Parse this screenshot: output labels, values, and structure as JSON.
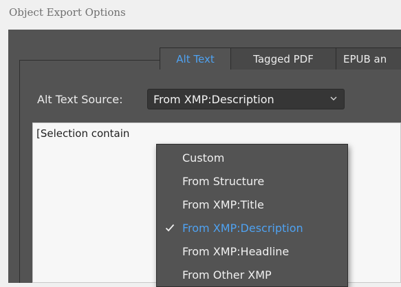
{
  "window": {
    "title": "Object Export Options"
  },
  "tabs": [
    {
      "label": "Alt Text",
      "active": true
    },
    {
      "label": "Tagged PDF",
      "active": false
    },
    {
      "label": "EPUB an",
      "active": false
    }
  ],
  "alt_text": {
    "source_label": "Alt Text Source:",
    "selected_value": "From XMP:Description",
    "text_content": "[Selection contain"
  },
  "dropdown": {
    "items": [
      {
        "label": "Custom",
        "selected": false
      },
      {
        "label": "From Structure",
        "selected": false
      },
      {
        "label": "From XMP:Title",
        "selected": false
      },
      {
        "label": "From XMP:Description",
        "selected": true
      },
      {
        "label": "From XMP:Headline",
        "selected": false
      },
      {
        "label": "From Other XMP",
        "selected": false
      }
    ]
  },
  "colors": {
    "dialog_background": "#535353",
    "accent": "#4fa2f1",
    "field_background": "#363636"
  },
  "icons": {
    "chevron": "chevron-down-icon",
    "check": "checkmark-icon"
  }
}
